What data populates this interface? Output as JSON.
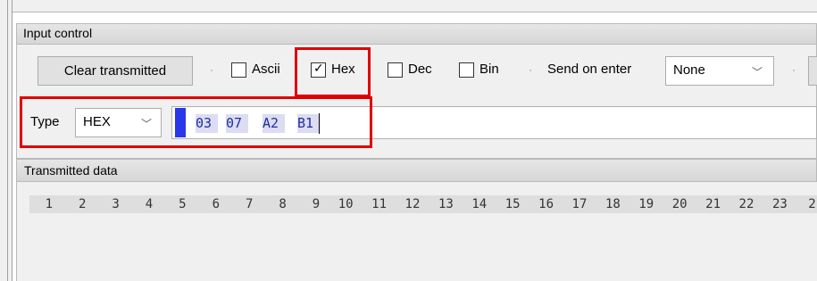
{
  "input_control": {
    "title": "Input control",
    "clear_label": "Clear transmitted",
    "checkboxes": [
      {
        "label": "Ascii",
        "checked": false
      },
      {
        "label": "Hex",
        "checked": true
      },
      {
        "label": "Dec",
        "checked": false
      },
      {
        "label": "Bin",
        "checked": false
      }
    ],
    "send_on_enter_label": "Send on enter",
    "send_on_enter_value": "None",
    "type_label": "Type",
    "type_value": "HEX",
    "hex_bytes": [
      "03",
      "07",
      "A2",
      "B1"
    ],
    "checkmark": "✓"
  },
  "transmitted": {
    "title": "Transmitted data",
    "columns": [
      "1",
      "2",
      "3",
      "4",
      "5",
      "6",
      "7",
      "8",
      "9",
      "10",
      "11",
      "12",
      "13",
      "14",
      "15",
      "16",
      "17",
      "18",
      "19",
      "20",
      "21",
      "22",
      "23",
      "2"
    ]
  },
  "colors": {
    "highlight_box": "#e00000",
    "cursor_block": "#2a37e8",
    "hex_byte_bg": "#dcdcf2"
  }
}
